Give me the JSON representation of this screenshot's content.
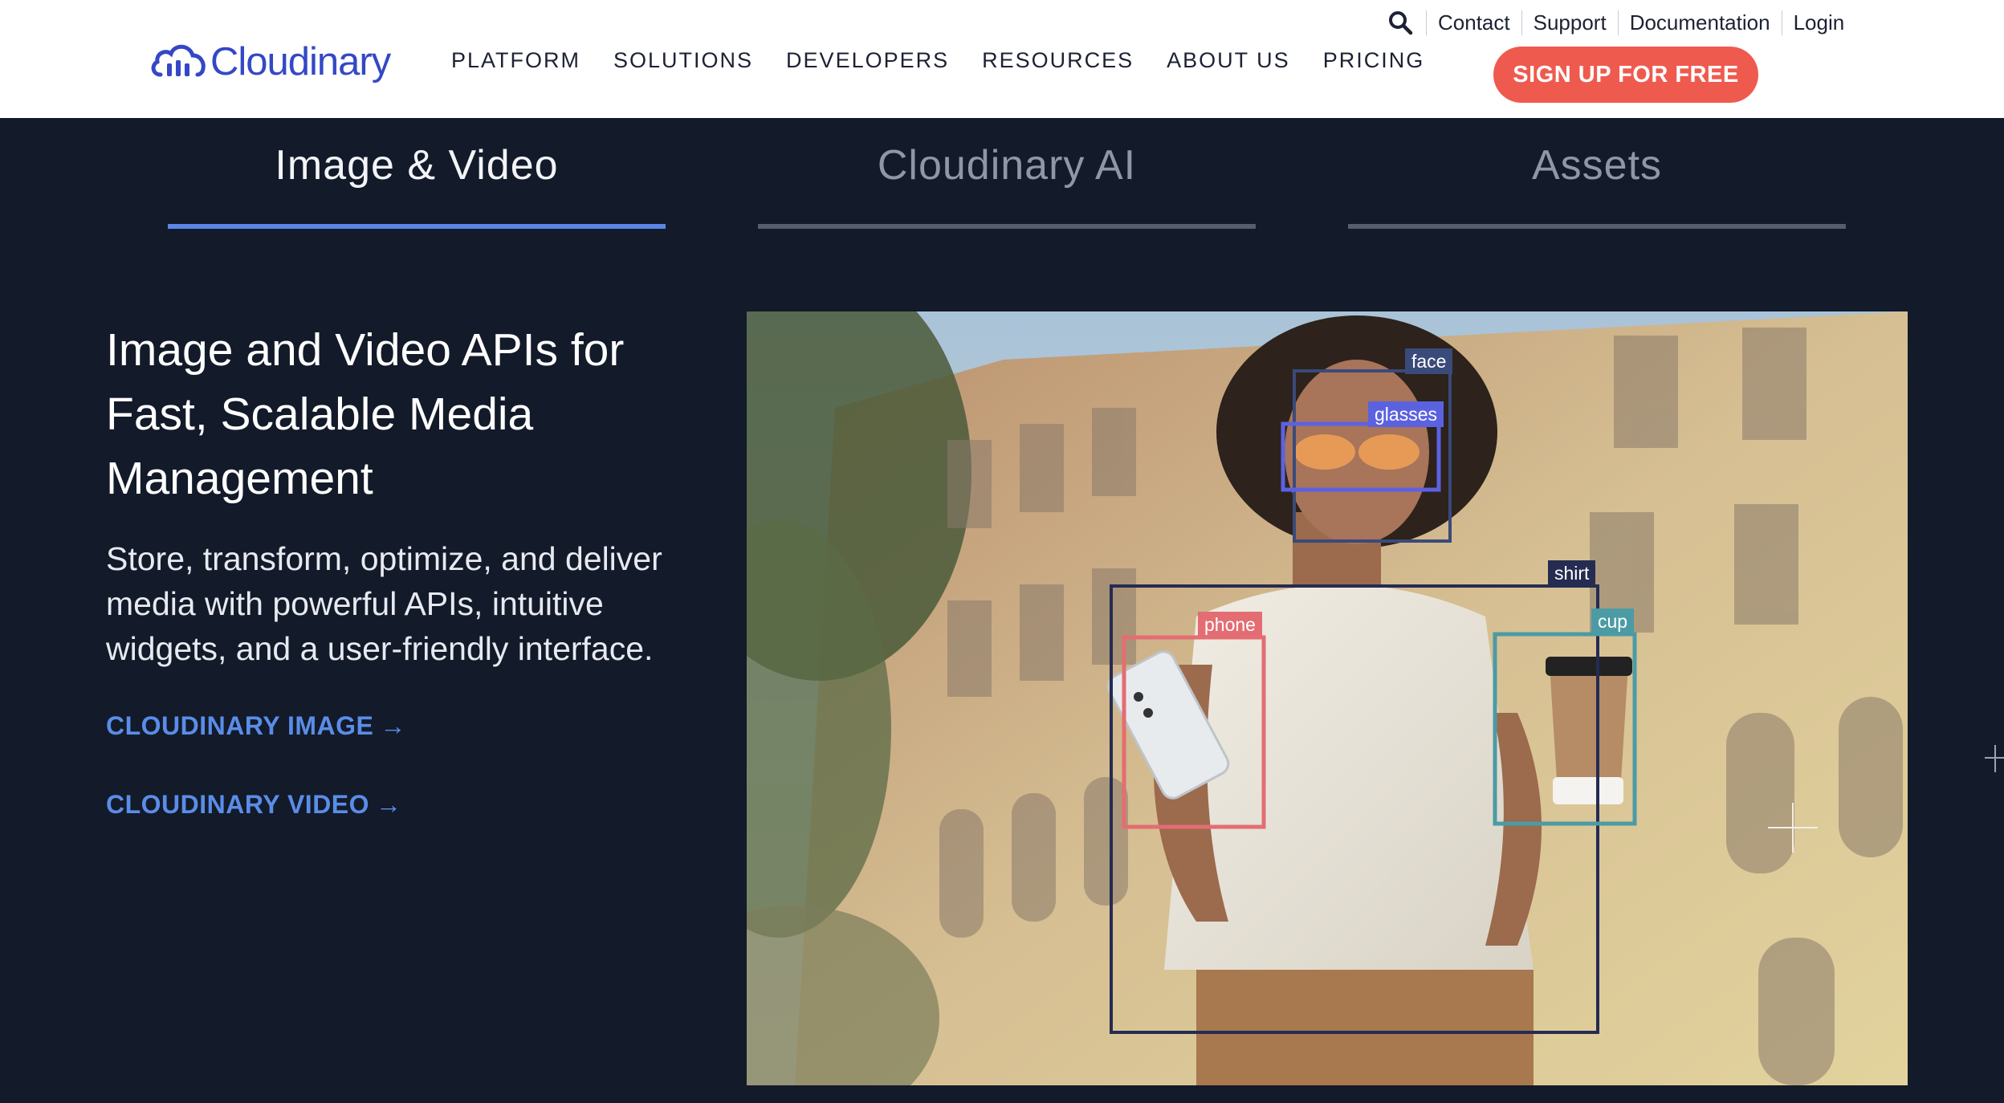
{
  "header": {
    "logo_text": "Cloudinary",
    "nav": [
      "PLATFORM",
      "SOLUTIONS",
      "DEVELOPERS",
      "RESOURCES",
      "ABOUT US",
      "PRICING"
    ],
    "util_links": [
      "Contact",
      "Support",
      "Documentation",
      "Login"
    ],
    "signup_label": "SIGN UP FOR FREE",
    "search_icon": "search-icon"
  },
  "tabs": [
    {
      "label": "Image & Video",
      "active": true
    },
    {
      "label": "Cloudinary AI",
      "active": false
    },
    {
      "label": "Assets",
      "active": false
    }
  ],
  "hero": {
    "headline_lines": [
      "Image and Video APIs for",
      "Fast, Scalable Media",
      "Management"
    ],
    "subtext_lines": [
      "Store, transform, optimize, and deliver",
      "media with powerful APIs, intuitive",
      "widgets, and a user-friendly interface."
    ],
    "links": [
      {
        "label": "CLOUDINARY IMAGE",
        "arrow": "→"
      },
      {
        "label": "CLOUDINARY VIDEO",
        "arrow": "→"
      }
    ]
  },
  "image": {
    "labels": {
      "face": "face",
      "glasses": "glasses",
      "shirt": "shirt",
      "phone": "phone",
      "cup": "cup"
    }
  },
  "colors": {
    "brand": "#3448c5",
    "signup": "#ef5a4f",
    "link": "#5a8de8",
    "tab_active": "#5b86e5",
    "background": "#131a29"
  }
}
